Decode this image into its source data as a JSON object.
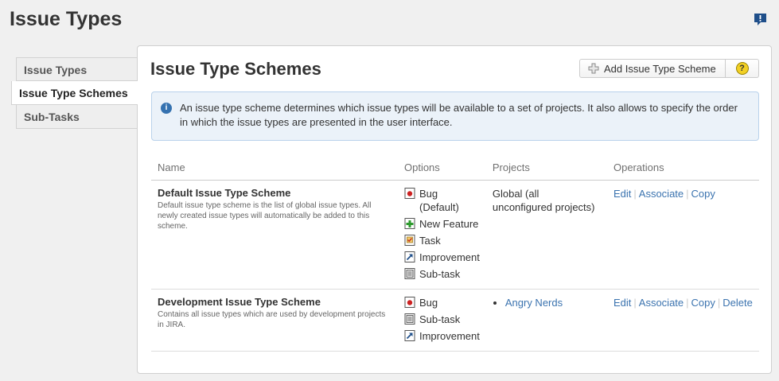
{
  "page": {
    "title": "Issue Types"
  },
  "sidebar": {
    "items": [
      {
        "label": "Issue Types"
      },
      {
        "label": "Issue Type Schemes"
      },
      {
        "label": "Sub-Tasks"
      }
    ]
  },
  "panel": {
    "title": "Issue Type Schemes",
    "add_button": "Add Issue Type Scheme",
    "help_button_icon": "help-icon",
    "info_icon": "info-icon",
    "info_text": "An issue type scheme determines which issue types will be available to a set of projects. It also allows to specify the order in which the issue types are presented in the user interface."
  },
  "table": {
    "headers": {
      "name": "Name",
      "options": "Options",
      "projects": "Projects",
      "operations": "Operations"
    },
    "rows": [
      {
        "name": "Default Issue Type Scheme",
        "description": "Default issue type scheme is the list of global issue types. All newly created issue types will automatically be added to this scheme.",
        "options": [
          {
            "label": "Bug",
            "extra": "(Default)",
            "icon": "bug-icon"
          },
          {
            "label": "New Feature",
            "icon": "new-feature-icon"
          },
          {
            "label": "Task",
            "icon": "task-icon"
          },
          {
            "label": "Improvement",
            "icon": "improvement-icon"
          },
          {
            "label": "Sub-task",
            "icon": "subtask-icon"
          }
        ],
        "projects_text": "Global (all unconfigured projects)",
        "operations": [
          "Edit",
          "Associate",
          "Copy"
        ]
      },
      {
        "name": "Development Issue Type Scheme",
        "description": "Contains all issue types which are used by development projects in JIRA.",
        "options": [
          {
            "label": "Bug",
            "icon": "bug-icon"
          },
          {
            "label": "Sub-task",
            "icon": "subtask-icon"
          },
          {
            "label": "Improvement",
            "icon": "improvement-icon"
          }
        ],
        "projects": [
          "Angry Nerds"
        ],
        "operations": [
          "Edit",
          "Associate",
          "Copy",
          "Delete"
        ]
      }
    ]
  },
  "colors": {
    "link": "#3b73af",
    "info_bg": "#ebf2f9",
    "info_border": "#b9d2eb",
    "feedback_icon": "#1f4f8a"
  }
}
